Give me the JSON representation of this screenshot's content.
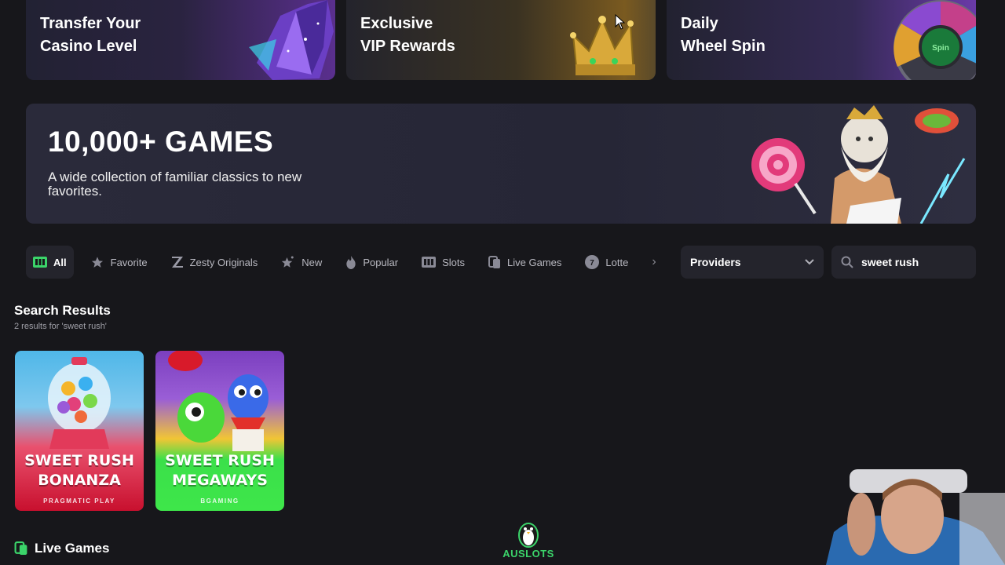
{
  "promos": [
    {
      "line1": "Transfer Your",
      "line2": "Casino Level"
    },
    {
      "line1": "Exclusive",
      "line2": "VIP Rewards"
    },
    {
      "line1": "Daily",
      "line2": "Wheel Spin"
    }
  ],
  "wheel_label": "Spin",
  "banner": {
    "title": "10,000+ GAMES",
    "subtitle": "A wide collection of familiar classics to new favorites."
  },
  "tabs": [
    {
      "label": "All",
      "icon": "slots-machine-icon",
      "active": true
    },
    {
      "label": "Favorite",
      "icon": "star-icon"
    },
    {
      "label": "Zesty Originals",
      "icon": "zesty-z-icon"
    },
    {
      "label": "New",
      "icon": "sparkle-star-icon"
    },
    {
      "label": "Popular",
      "icon": "flame-icon"
    },
    {
      "label": "Slots",
      "icon": "slot-reels-icon"
    },
    {
      "label": "Live Games",
      "icon": "cards-icon"
    },
    {
      "label": "Lotte",
      "icon": "lottery-ball-icon"
    }
  ],
  "providers": {
    "label": "Providers"
  },
  "search": {
    "value": "sweet rush"
  },
  "results": {
    "title": "Search Results",
    "subtitle": "2 results for 'sweet rush'",
    "games": [
      {
        "line1": "SWEET RUSH",
        "line2": "BONANZA",
        "provider": "PRAGMATIC PLAY"
      },
      {
        "line1": "SWEET RUSH",
        "line2": "MEGAWAYS",
        "provider": "BGAMING"
      }
    ]
  },
  "live_games": {
    "title": "Live Games"
  },
  "watermark": {
    "text": "AUSLOTS"
  },
  "colors": {
    "background": "#17171b",
    "accent": "#3bd46a",
    "panel": "#24242c"
  }
}
